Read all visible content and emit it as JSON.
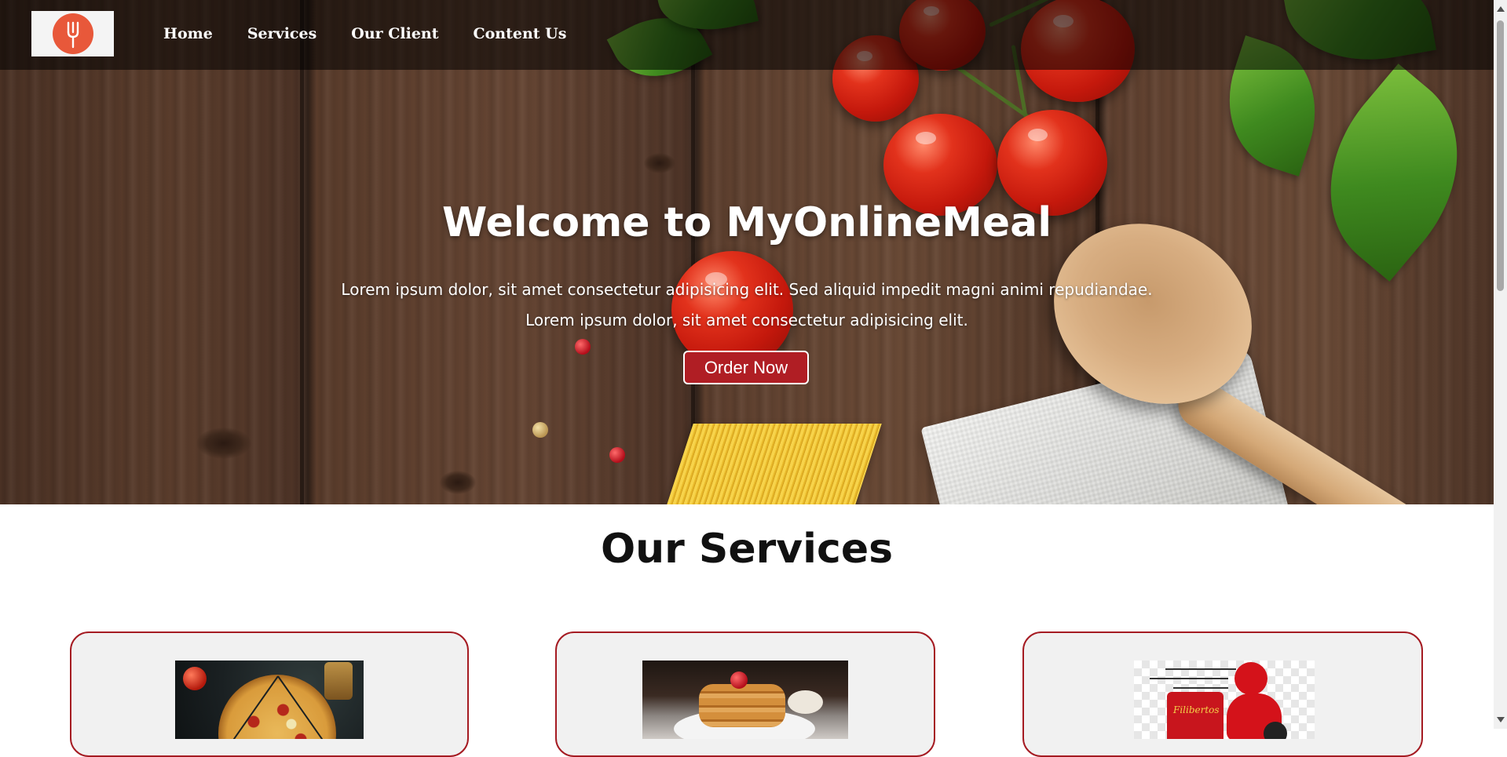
{
  "nav": {
    "logo_icon": "fork-icon",
    "items": [
      {
        "label": "Home"
      },
      {
        "label": "Services"
      },
      {
        "label": "Our Client"
      },
      {
        "label": "Content Us"
      }
    ]
  },
  "hero": {
    "title": "Welcome to MyOnlineMeal",
    "line1": "Lorem ipsum dolor, sit amet consectetur adipisicing elit. Sed aliquid impedit magni animi repudiandae.",
    "line2": "Lorem ipsum dolor, sit amet consectetur adipisicing elit.",
    "button_label": "Order Now"
  },
  "services": {
    "title": "Our Services",
    "cards": [
      {
        "image": "pizza-image"
      },
      {
        "image": "pancake-image"
      },
      {
        "image": "delivery-image",
        "image_text": "Filibertos"
      }
    ]
  },
  "colors": {
    "accent": "#b01e24",
    "card_border": "#a51b22",
    "logo": "#e8583a"
  }
}
